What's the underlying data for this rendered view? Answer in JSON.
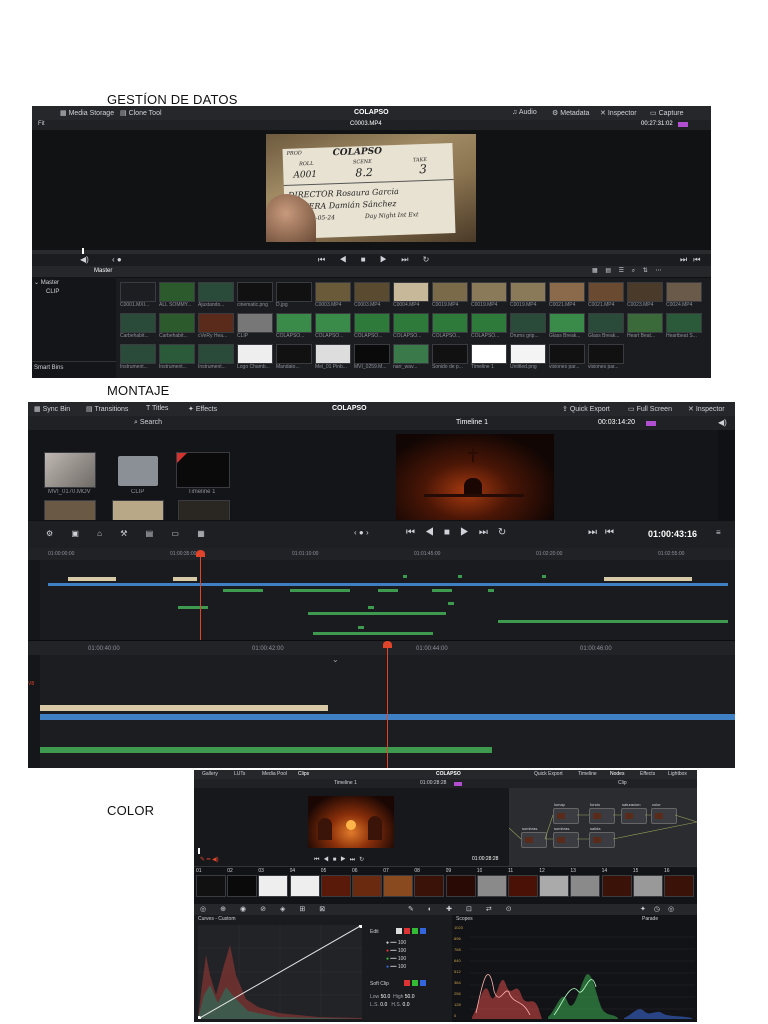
{
  "captions": {
    "datos": "GESTÍON DE DATOS",
    "montaje": "MONTAJE",
    "color": "COLOR"
  },
  "datos": {
    "title": "COLAPSO",
    "left_tabs": [
      "Media Storage",
      "Clone Tool"
    ],
    "right_tabs": [
      "Audio",
      "Metadata",
      "Inspector",
      "Capture"
    ],
    "fit": "Fit",
    "clip_name": "C0003.MP4",
    "timecode": "00:27:31:02",
    "bin_master": "Master",
    "bin_clip": "CLIP",
    "smart_bins": "Smart Bins",
    "clapper": {
      "prod": "PROD",
      "title": "COLAPSO",
      "roll": "ROLL",
      "scene": "SCENE",
      "take": "TAKE",
      "roll_v": "A001",
      "scene_v": "8.2",
      "take_v": "3",
      "director": "DIRECTOR Rosaura Garcia",
      "camera": "CAMERA Damián Sánchez",
      "date": "DATE 19-05-24",
      "daynight": "Day Night Int Ext"
    },
    "row1": [
      "C0001.MXI...",
      "ALL SOMMY...",
      "Ajustando...",
      "cinematic.png",
      "D.jpg",
      "C0003.MP4",
      "C0003.MP4",
      "C0004.MP4",
      "C0019.MP4",
      "C0019.MP4",
      "C0019.MP4",
      "C0021.MP4",
      "C0021.MP4",
      "C0023.MP4",
      "C0024.MP4"
    ],
    "row2": [
      "Carbehabit...",
      "Carbehabit...",
      "cVeRy Hea...",
      "CLIP",
      "COLAPSO...",
      "COLAPSO...",
      "COLAPSO...",
      "COLAPSO...",
      "COLAPSO...",
      "COLAPSO...",
      "Drums grip...",
      "Glass Break...",
      "Glass Break...",
      "Heart Beat...",
      "Heartbeat S..."
    ],
    "row3": [
      "Instrument...",
      "Instrument...",
      "Instrument...",
      "Logo Chamb...",
      "Mandato...",
      "Mel_01 Pinb...",
      "MVI_0259.M...",
      "narr_wav...",
      "Sonido de p...",
      "Timeline 1",
      "Untitled.png",
      "visiones par...",
      "visiones par..."
    ]
  },
  "montaje": {
    "title": "COLAPSO",
    "left_tabs": [
      "Sync Bin",
      "Transitions",
      "Titles",
      "Effects"
    ],
    "right_tabs": [
      "Quick Export",
      "Full Screen",
      "Inspector"
    ],
    "search": "Search",
    "timeline_name": "Timeline 1",
    "duration": "00:03:14:20",
    "timecode": "01:00:43:16",
    "bins": [
      "MVI_0170.MOV",
      "CLIP",
      "Timeline 1"
    ],
    "ruler_upper": [
      "01:00:00:00",
      "01:00:35:00",
      "01:01:10:00",
      "01:01:45:00",
      "01:02:20:00",
      "01:02:55:00"
    ],
    "ruler_lower": [
      "01:00:40:00",
      "01:00:42:00",
      "01:00:44:00",
      "01:00:46:00"
    ],
    "track_v": "V8"
  },
  "color": {
    "title": "COLAPSO",
    "top_tabs": [
      "Gallery",
      "LUTs",
      "Media Pool",
      "Clips"
    ],
    "right_tabs": [
      "Quick Export",
      "Timeline",
      "Nodes",
      "Effects",
      "Lightbox"
    ],
    "timeline_name": "Timeline 1",
    "tc_top": "01:00:28:28",
    "tc_viewer": "01:00:28:28",
    "clip_label": "Clip",
    "nodes": [
      "lumap",
      "sombras",
      "fondo",
      "saturacion",
      "sombras",
      "salida",
      "color"
    ],
    "clip_nums": [
      "01",
      "02",
      "03",
      "04",
      "05",
      "06",
      "07",
      "08",
      "09",
      "10",
      "11",
      "12",
      "13",
      "14",
      "15",
      "16"
    ],
    "curves_title": "Curves - Custom",
    "edit": "Edit",
    "soft_clip": "Soft Clip",
    "curve_vals": [
      "100",
      "100",
      "100",
      "100"
    ],
    "low": "Low",
    "high": "High",
    "low_v": "50.0",
    "high_v": "50.0",
    "ls": "L.S.",
    "hs": "H.S.",
    "ls_v": "0.0",
    "hs_v": "0.0",
    "scopes": "Scopes",
    "parade": "Parade",
    "scope_ticks": [
      "1023",
      "896",
      "768",
      "640",
      "512",
      "384",
      "256",
      "128",
      "0"
    ]
  }
}
